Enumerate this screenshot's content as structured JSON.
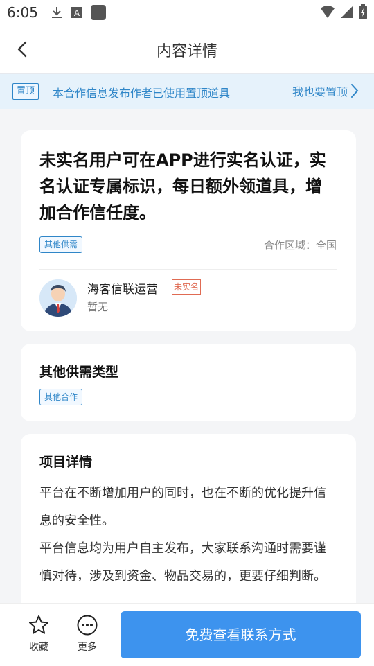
{
  "status_bar": {
    "time": "6:05",
    "icons": [
      "download-icon",
      "font-a-icon",
      "app-square-icon"
    ],
    "right_icons": [
      "wifi-icon",
      "signal-icon",
      "battery-icon"
    ]
  },
  "navbar": {
    "title": "内容详情",
    "back_icon": "chevron-left-icon"
  },
  "notice": {
    "tag": "置顶",
    "message": "本合作信息发布作者已使用置顶道具",
    "cta": "我也要置顶"
  },
  "post": {
    "title": "未实名用户可在APP进行实名认证，实名认证专属标识，每日额外领道具，增加合作信任度。",
    "category": "其他供需",
    "region": "合作区域：全国",
    "author": {
      "name": "海客信联运营",
      "badge": "未实名",
      "subtitle": "暂无"
    }
  },
  "type_section": {
    "title": "其他供需类型",
    "tag": "其他合作"
  },
  "detail_section": {
    "title": "项目详情",
    "paragraphs": [
      "平台在不断增加用户的同时，也在不断的优化提升信息的安全性。",
      "平台信息均为用户自主发布，大家联系沟通时需要谨慎对待，涉及到资金、物品交易的，更要仔细判断。"
    ]
  },
  "bottom_bar": {
    "favorite_label": "收藏",
    "more_label": "更多",
    "contact_button": "免费查看联系方式"
  },
  "colors": {
    "accent": "#2f86c8",
    "button": "#3d93ee",
    "warning": "#e06b53",
    "notice_bg": "#e6f2fb"
  }
}
